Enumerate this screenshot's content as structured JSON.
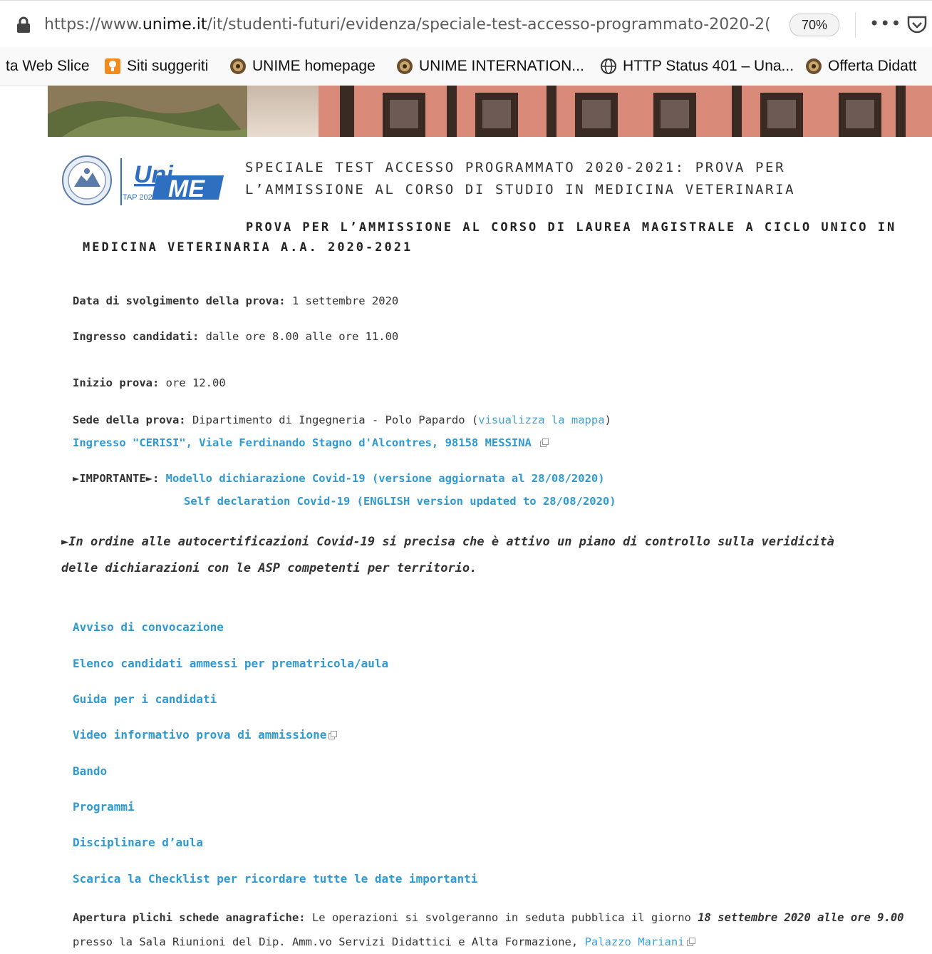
{
  "browser": {
    "url_prefix": "https://www.",
    "url_domain": "unime.it",
    "url_path": "/it/studenti-futuri/evidenza/speciale-test-accesso-programmato-2020-2(",
    "zoom": "70%",
    "menu": "•••",
    "bookmarks": [
      {
        "label": "ta Web Slice"
      },
      {
        "label": "Siti suggeriti"
      },
      {
        "label": "UNIME homepage"
      },
      {
        "label": "UNIME INTERNATION..."
      },
      {
        "label": "HTTP Status 401 – Una..."
      },
      {
        "label": "Offerta Didatt"
      }
    ]
  },
  "logo": {
    "text1": "Uni",
    "text2": "ME",
    "tag": "TAP 2020-21"
  },
  "page": {
    "title_line1": "SPECIALE TEST ACCESSO PROGRAMMATO 2020-2021: PROVA PER",
    "title_line2": "L’AMMISSIONE AL CORSO DI STUDIO IN MEDICINA VETERINARIA",
    "subtitle": "PROVA PER L’AMMISSIONE AL CORSO DI LAUREA MAGISTRALE A CICLO UNICO IN MEDICINA VETERINARIA A.A. 2020-2021",
    "date_label": "Data di svolgimento della prova:",
    "date_value": " 1 settembre 2020",
    "entry_label": "Ingresso candidati:",
    "entry_value": " dalle ore 8.00 alle ore 11.00",
    "start_label": "Inizio prova:",
    "start_value": " ore 12.00",
    "venue_label": "Sede della prova:",
    "venue_value": " Dipartimento di Ingegneria - Polo Papardo (",
    "venue_map_link": "visualizza la mappa",
    "venue_close": ")",
    "venue_address_link": "Ingresso \"CERISI\", Viale Ferdinando Stagno d'Alcontres, 98158 MESSINA",
    "important_label": "►IMPORTANTE►:",
    "covid_link_it": "Modello dichiarazione Covid-19 (versione aggiornata al 28/08/2020)",
    "covid_link_en": "Self declaration Covid-19 (ENGLISH version updated to 28/08/2020)",
    "note": "►In ordine alle autocertificazioni Covid-19 si precisa che è attivo un piano di controllo sulla veridicità delle dichiarazioni con le ASP competenti per territorio.",
    "links": [
      "Avviso di convocazione",
      "Elenco candidati ammessi per prematricola/aula",
      "Guida per i candidati",
      "Video informativo prova di ammissione",
      "Bando",
      "Programmi",
      "Disciplinare d’aula",
      "Scarica la Checklist per ricordare tutte le date importanti"
    ],
    "opening_label": "Apertura plichi schede anagrafiche:",
    "opening_text": " Le operazioni si svolgeranno in seduta pubblica il giorno ",
    "opening_date": "18 settembre 2020 alle ore 9.00",
    "opening_place": "presso la Sala Riunioni del Dip. Amm.vo Servizi Didattici e Alta Formazione, ",
    "opening_place_link": "Palazzo Mariani"
  },
  "colors": {
    "link": "#2d9ad3",
    "text": "#333333"
  }
}
